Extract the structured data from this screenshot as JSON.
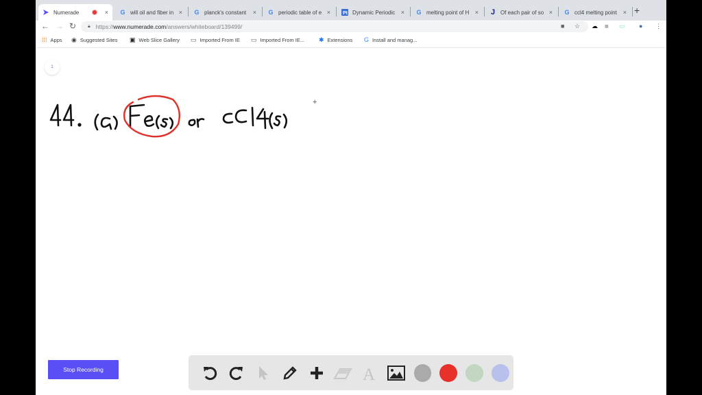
{
  "tabs": [
    {
      "title": "Numerade",
      "icon": "numerade-logo-icon",
      "active": true,
      "recording": true
    },
    {
      "title": "will oil and fiber in",
      "icon": "google-icon"
    },
    {
      "title": "planck's constant",
      "icon": "google-icon"
    },
    {
      "title": "periodic table of e",
      "icon": "google-icon"
    },
    {
      "title": "Dynamic Periodic",
      "icon": "ptable-icon"
    },
    {
      "title": "melting point of H",
      "icon": "google-icon"
    },
    {
      "title": "Of each pair of so",
      "icon": "j-icon"
    },
    {
      "title": "ccl4 melting point",
      "icon": "google-icon"
    }
  ],
  "tab_close_glyph": "×",
  "new_tab_glyph": "+",
  "address": {
    "scheme": "https://",
    "host": "www.numerade.com",
    "path": "/answers/whiteboard/139499/"
  },
  "bookmarks": [
    {
      "label": "Apps",
      "icon": "apps-grid-icon"
    },
    {
      "label": "Suggested Sites",
      "icon": "globe-icon"
    },
    {
      "label": "Web Slice Gallery",
      "icon": "web-slice-icon"
    },
    {
      "label": "Imported From IE",
      "icon": "folder-icon"
    },
    {
      "label": "Imported From IE...",
      "icon": "folder-icon"
    },
    {
      "label": "Extensions",
      "icon": "puzzle-icon"
    },
    {
      "label": "Install and manag...",
      "icon": "google-icon"
    }
  ],
  "whiteboard": {
    "page_number": "1",
    "handwriting": "44. (a) Fe(s) or CCl4(s)",
    "circled_answer": "Fe(s)",
    "ink_color": "#111111",
    "circle_color": "#e0302a"
  },
  "stop_recording_label": "Stop Recording",
  "drawing_tools": [
    "undo",
    "redo",
    "select",
    "pen",
    "add",
    "eraser",
    "text",
    "image"
  ],
  "colors": {
    "button_accent": "#5a4ff5",
    "swatches": [
      "#aaaaaa",
      "#e8312a",
      "#c3d6c2",
      "#b8c0ec"
    ]
  }
}
